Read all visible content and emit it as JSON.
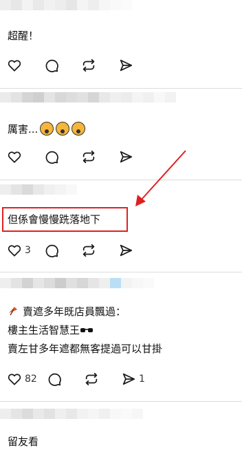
{
  "posts": [
    {
      "text": "超醒！",
      "likes": "",
      "reposts": ""
    },
    {
      "text": "厲害...",
      "likes": "",
      "reposts": ""
    },
    {
      "text": "但係會慢慢跣落地下",
      "likes": "3",
      "reposts": ""
    },
    {
      "line1": "賣遮多年既店員飄過：",
      "line2": "樓主生活智慧王",
      "line3": "賣左甘多年遮都無客提過可以甘掛",
      "likes": "82",
      "reposts": "1"
    },
    {
      "text": "留友看"
    }
  ],
  "icons": {
    "like": "heart-icon",
    "comment": "comment-icon",
    "repost": "repost-icon",
    "share": "send-icon",
    "arrow": "red-arrow-annotation"
  },
  "colors": {
    "highlight": "#e02020",
    "divider": "#dcdcdc"
  }
}
